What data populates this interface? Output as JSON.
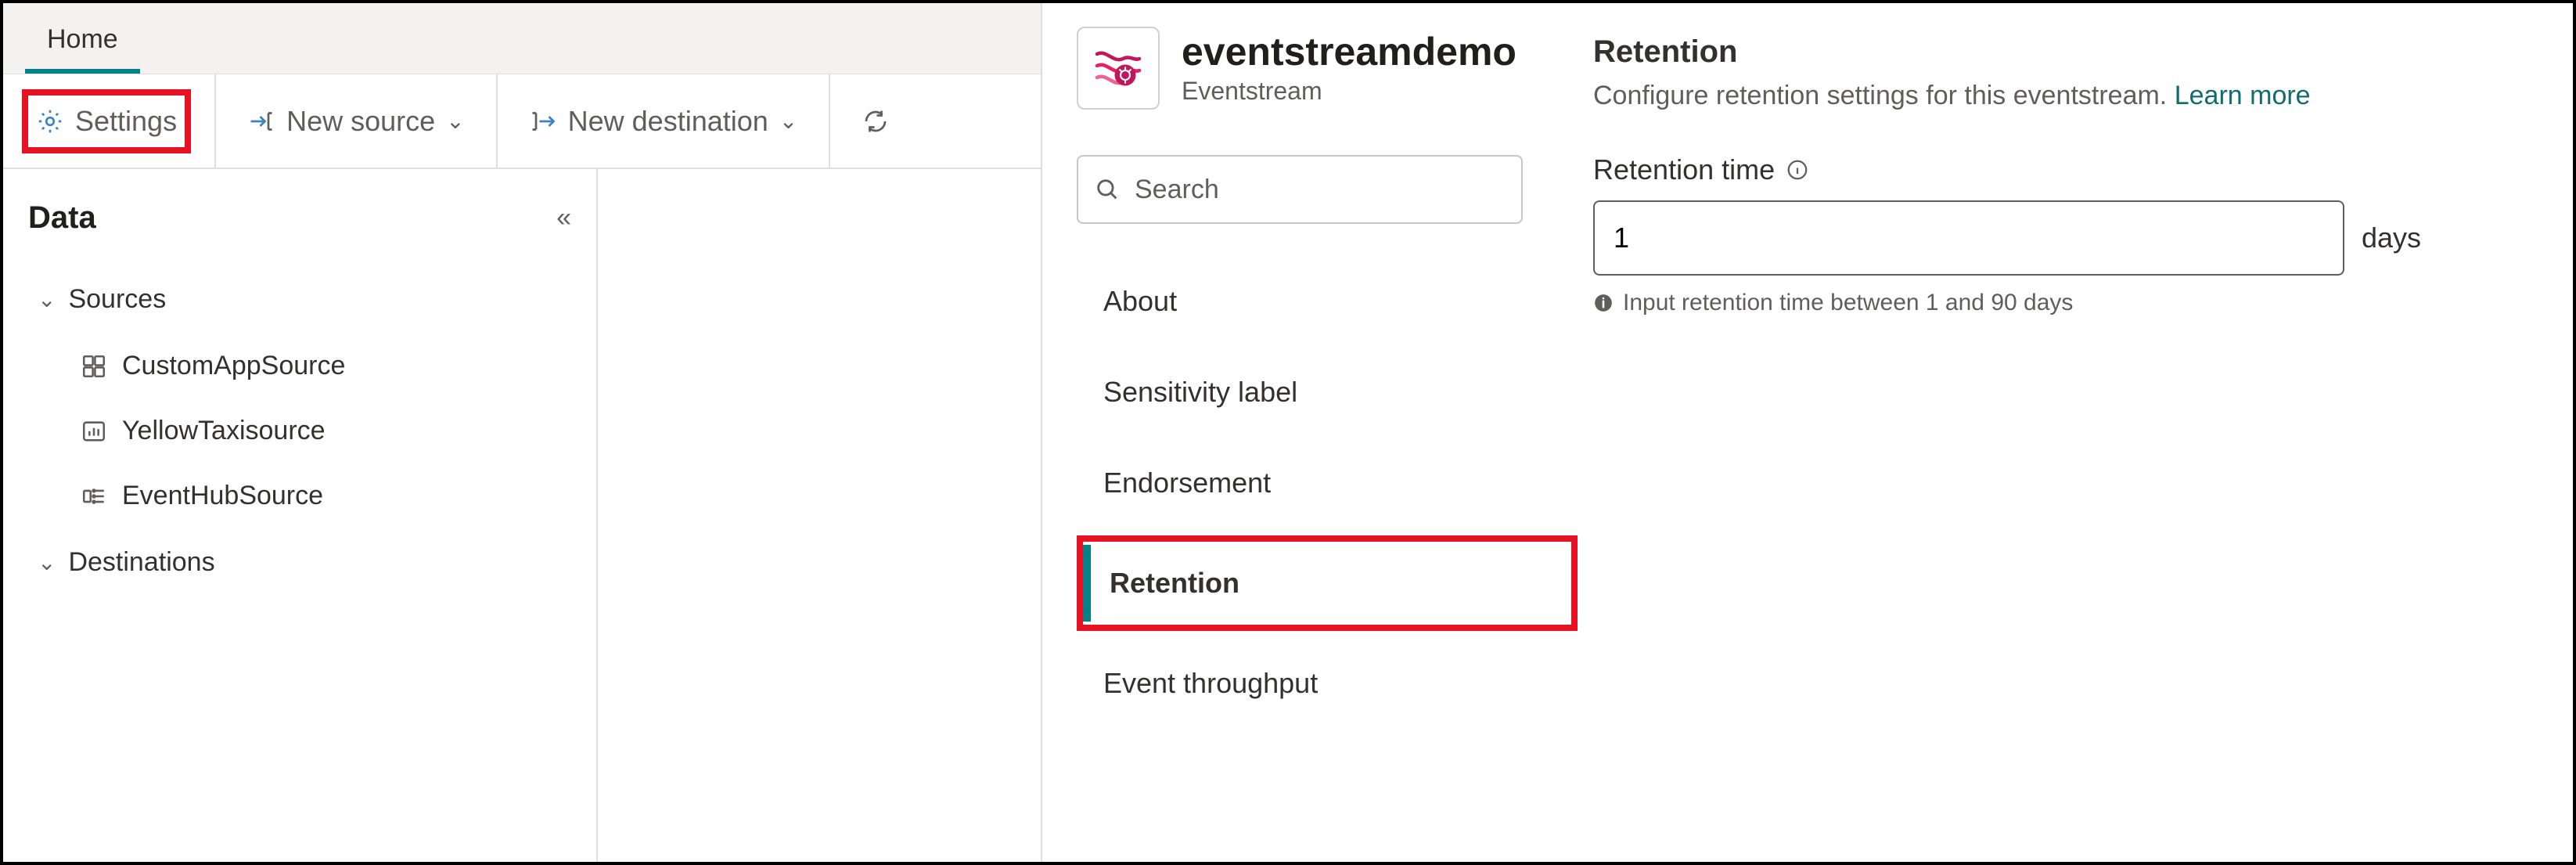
{
  "tabs": {
    "home": "Home"
  },
  "toolbar": {
    "settings": "Settings",
    "new_source": "New source",
    "new_destination": "New destination"
  },
  "sidebar": {
    "title": "Data",
    "sources_label": "Sources",
    "destinations_label": "Destinations",
    "sources": [
      {
        "name": "CustomAppSource"
      },
      {
        "name": "YellowTaxisource"
      },
      {
        "name": "EventHubSource"
      }
    ]
  },
  "panel": {
    "title": "eventstreamdemo",
    "subtitle": "Eventstream",
    "search_placeholder": "Search",
    "nav": {
      "about": "About",
      "sensitivity": "Sensitivity label",
      "endorsement": "Endorsement",
      "retention": "Retention",
      "throughput": "Event throughput"
    },
    "section": {
      "title": "Retention",
      "desc": "Configure retention settings for this eventstream.",
      "learn_more": "Learn more",
      "field_label": "Retention time",
      "value": "1",
      "unit": "days",
      "hint": "Input retention time between 1 and 90 days"
    }
  }
}
